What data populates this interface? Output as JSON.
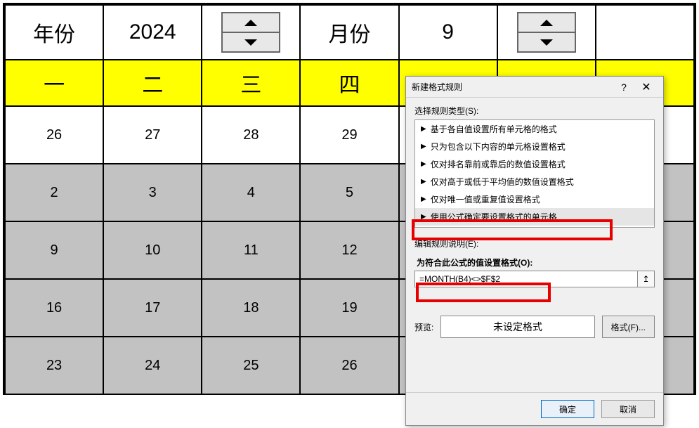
{
  "header": {
    "year_label": "年份",
    "year_value": "2024",
    "month_label": "月份",
    "month_value": "9"
  },
  "weekday_row": [
    "一",
    "二",
    "三",
    "四",
    "",
    "",
    ""
  ],
  "calendar": {
    "rows": [
      [
        "26",
        "27",
        "28",
        "29",
        "",
        "",
        ""
      ],
      [
        "2",
        "3",
        "4",
        "5",
        "",
        "",
        ""
      ],
      [
        "9",
        "10",
        "11",
        "12",
        "",
        "",
        ""
      ],
      [
        "16",
        "17",
        "18",
        "19",
        "",
        "",
        ""
      ],
      [
        "23",
        "24",
        "25",
        "26",
        "",
        "",
        ""
      ]
    ]
  },
  "dialog": {
    "title": "新建格式规则",
    "select_rule_label": "选择规则类型(S):",
    "rule_types": [
      "基于各自值设置所有单元格的格式",
      "只为包含以下内容的单元格设置格式",
      "仅对排名靠前或靠后的数值设置格式",
      "仅对高于或低于平均值的数值设置格式",
      "仅对唯一值或重复值设置格式",
      "使用公式确定要设置格式的单元格"
    ],
    "edit_desc_label": "编辑规则说明(E):",
    "formula_label": "为符合此公式的值设置格式(O):",
    "formula_value": "=MONTH(B4)<>$F$2",
    "preview_label": "预览:",
    "preview_value": "未设定格式",
    "format_button": "格式(F)...",
    "ok_button": "确定",
    "cancel_button": "取消",
    "help_icon": "?",
    "close_icon": "✕",
    "range_icon": "↥"
  }
}
